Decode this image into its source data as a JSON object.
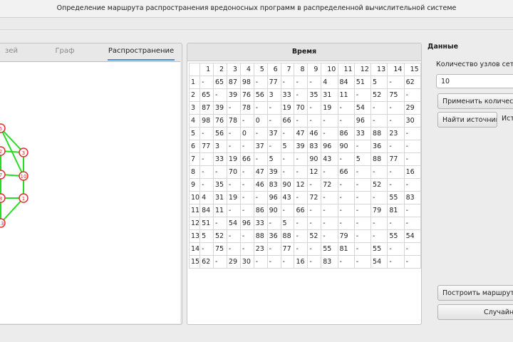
{
  "window": {
    "title": "Определение маршрута распространения вредоносных программ в распределенной вычислительной системе"
  },
  "tabs": [
    {
      "label": "зей"
    },
    {
      "label": "Граф"
    },
    {
      "label": "Распространение"
    }
  ],
  "table": {
    "title": "Время",
    "columns": [
      "1",
      "2",
      "3",
      "4",
      "5",
      "6",
      "7",
      "8",
      "9",
      "10",
      "11",
      "12",
      "13",
      "14",
      "15"
    ],
    "rows": [
      [
        "1",
        [
          "-",
          "65",
          "87",
          "98",
          "-",
          "77",
          "-",
          "-",
          "-",
          "4",
          "84",
          "51",
          "5",
          "-",
          "62"
        ]
      ],
      [
        "2",
        [
          "65",
          "-",
          "39",
          "76",
          "56",
          "3",
          "33",
          "-",
          "35",
          "31",
          "11",
          "-",
          "52",
          "75",
          "-"
        ]
      ],
      [
        "3",
        [
          "87",
          "39",
          "-",
          "78",
          "-",
          "-",
          "19",
          "70",
          "-",
          "19",
          "-",
          "54",
          "-",
          "-",
          "29"
        ]
      ],
      [
        "4",
        [
          "98",
          "76",
          "78",
          "-",
          "0",
          "-",
          "66",
          "-",
          "-",
          "-",
          "-",
          "96",
          "-",
          "-",
          "30"
        ]
      ],
      [
        "5",
        [
          "-",
          "56",
          "-",
          "0",
          "-",
          "37",
          "-",
          "47",
          "46",
          "-",
          "86",
          "33",
          "88",
          "23",
          "-"
        ]
      ],
      [
        "6",
        [
          "77",
          "3",
          "-",
          "-",
          "37",
          "-",
          "5",
          "39",
          "83",
          "96",
          "90",
          "-",
          "36",
          "-",
          "-"
        ]
      ],
      [
        "7",
        [
          "-",
          "33",
          "19",
          "66",
          "-",
          "5",
          "-",
          "-",
          "90",
          "43",
          "-",
          "5",
          "88",
          "77",
          "-"
        ]
      ],
      [
        "8",
        [
          "-",
          "-",
          "70",
          "-",
          "47",
          "39",
          "-",
          "-",
          "12",
          "-",
          "66",
          "-",
          "-",
          "-",
          "16"
        ]
      ],
      [
        "9",
        [
          "-",
          "35",
          "-",
          "-",
          "46",
          "83",
          "90",
          "12",
          "-",
          "72",
          "-",
          "-",
          "52",
          "-",
          "-"
        ]
      ],
      [
        "10",
        [
          "4",
          "31",
          "19",
          "-",
          "-",
          "96",
          "43",
          "-",
          "72",
          "-",
          "-",
          "-",
          "-",
          "55",
          "83"
        ]
      ],
      [
        "11",
        [
          "84",
          "11",
          "-",
          "-",
          "86",
          "90",
          "-",
          "66",
          "-",
          "-",
          "-",
          "-",
          "79",
          "81",
          "-"
        ]
      ],
      [
        "12",
        [
          "51",
          "-",
          "54",
          "96",
          "33",
          "-",
          "5",
          "-",
          "-",
          "-",
          "-",
          "-",
          "-",
          "-",
          "-"
        ]
      ],
      [
        "13",
        [
          "5",
          "52",
          "-",
          "-",
          "88",
          "36",
          "88",
          "-",
          "52",
          "-",
          "79",
          "-",
          "-",
          "55",
          "54"
        ]
      ],
      [
        "14",
        [
          "-",
          "75",
          "-",
          "-",
          "23",
          "-",
          "77",
          "-",
          "-",
          "55",
          "81",
          "-",
          "55",
          "-",
          "-"
        ]
      ],
      [
        "15",
        [
          "62",
          "-",
          "29",
          "30",
          "-",
          "-",
          "-",
          "16",
          "-",
          "83",
          "-",
          "-",
          "54",
          "-",
          "-"
        ]
      ]
    ]
  },
  "data_panel": {
    "title": "Данные",
    "node_count_label": "Количество узлов сети:",
    "node_count_value": "10",
    "apply_button": "Применить количество",
    "find_source_button": "Найти источник",
    "source_label": "Ист",
    "build_route_button": "Построить маршрут ра",
    "random_button": "Случайно"
  },
  "graph": {
    "edge_color": "#22dd22",
    "node_color": "#e03030",
    "nodes": [
      {
        "label": "5"
      },
      {
        "label": "2"
      },
      {
        "label": "3"
      },
      {
        "label": "7"
      },
      {
        "label": "10"
      },
      {
        "label": "8"
      },
      {
        "label": "1"
      },
      {
        "label": "13"
      }
    ]
  }
}
